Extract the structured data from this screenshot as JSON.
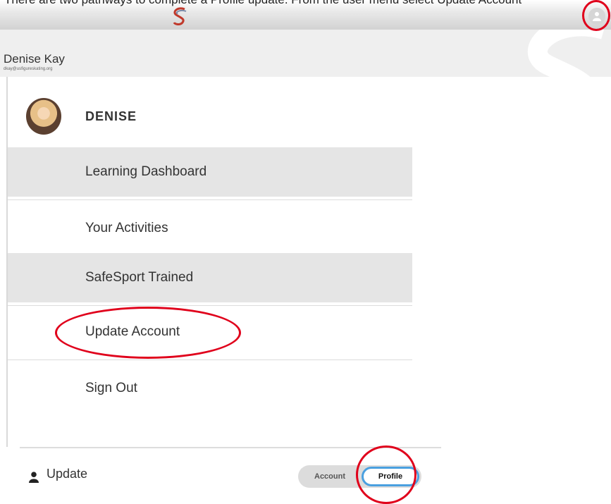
{
  "caption": "There are two pathways to complete a Profile update. From the user menu select Update Account",
  "header": {
    "user_name": "Denise Kay",
    "user_email": "dkay@usfigureskating.org",
    "logo_icon": "brand-s-logo",
    "user_button_icon": "user-icon"
  },
  "menu": {
    "username": "DENISE",
    "items": [
      {
        "label": "Learning Dashboard"
      },
      {
        "label": "Your Activities"
      },
      {
        "label": "SafeSport Trained"
      },
      {
        "label": "Update Account"
      },
      {
        "label": "Sign Out"
      }
    ]
  },
  "footer": {
    "update_label": "Update",
    "update_icon": "user-icon",
    "toggle_account": "Account",
    "toggle_profile": "Profile"
  },
  "colors": {
    "annotation_red": "#e0001b",
    "toggle_active_border": "#4aa0e0",
    "menu_shaded": "#e5e5e5"
  }
}
